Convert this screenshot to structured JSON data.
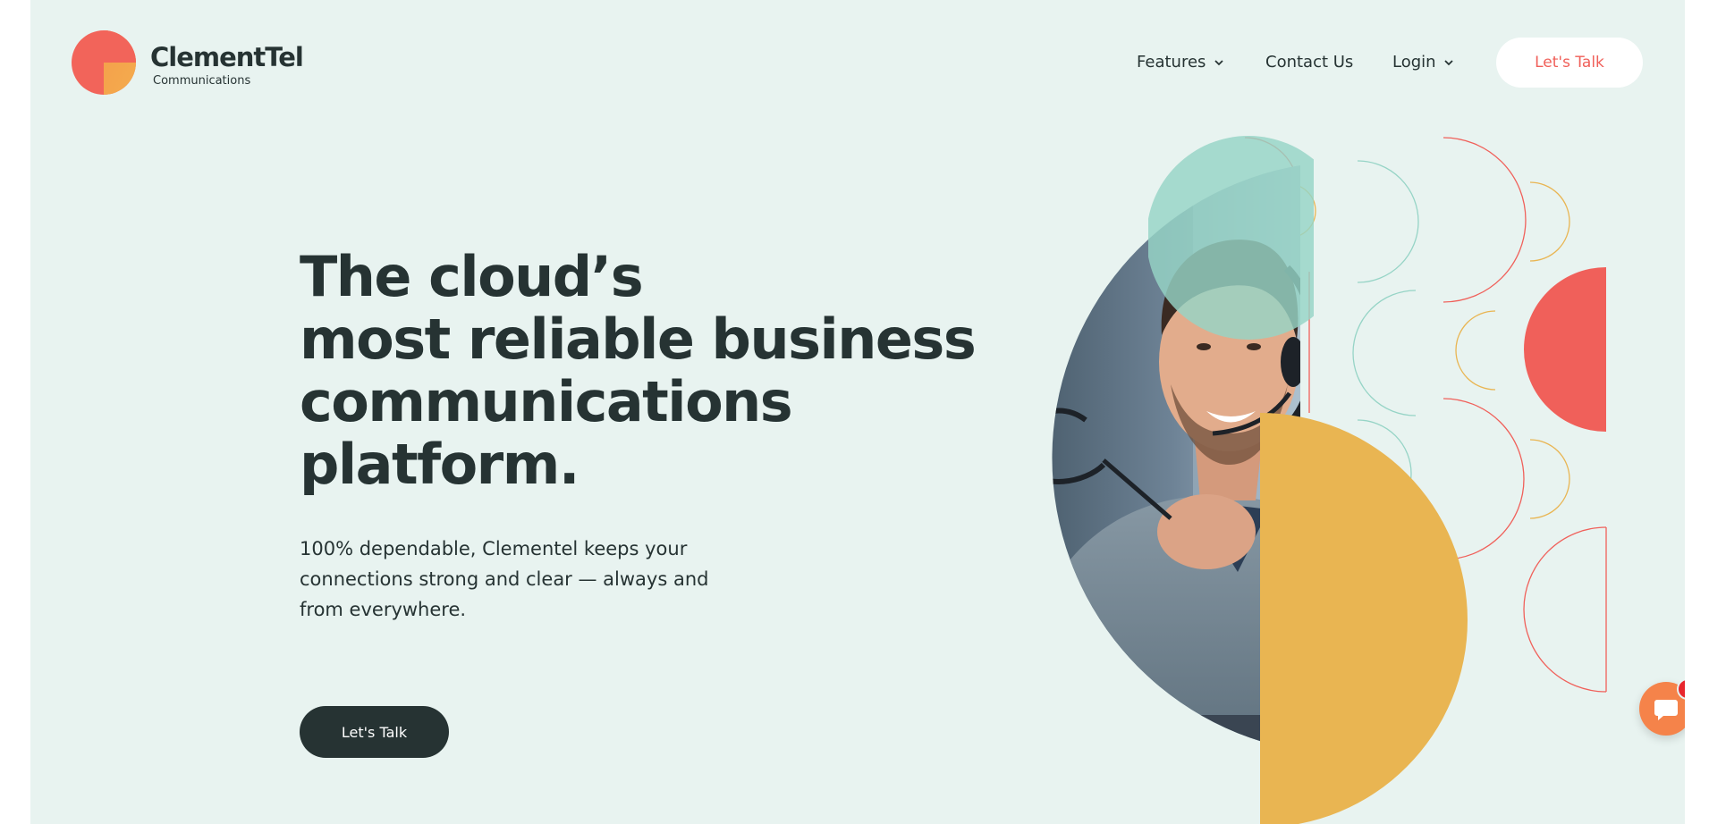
{
  "brand": {
    "name": "ClementTel",
    "tagline": "Communications"
  },
  "nav": {
    "items": [
      {
        "label": "Features",
        "has_dropdown": true
      },
      {
        "label": "Contact Us",
        "has_dropdown": false
      },
      {
        "label": "Login",
        "has_dropdown": true
      }
    ],
    "cta_label": "Let's Talk"
  },
  "hero": {
    "title_lines": [
      "The cloud’s",
      "most reliable business",
      "communications",
      "platform."
    ],
    "subtitle": "100% dependable, Clementel keeps your connections strong and clear — always and from everywhere.",
    "cta_label": "Let's Talk"
  },
  "chat": {
    "icon": "chat-bubble-icon",
    "badge_count": "1"
  },
  "colors": {
    "background": "#e8f3f0",
    "text": "#263333",
    "coral": "#f0605a",
    "mustard": "#e9b552",
    "mint": "#96d4c6",
    "orange": "#f5834a"
  }
}
